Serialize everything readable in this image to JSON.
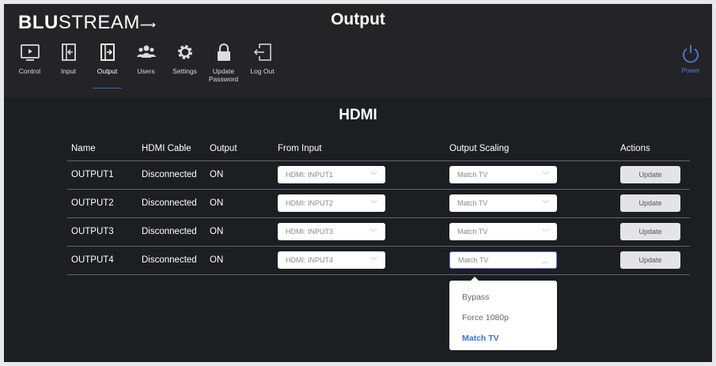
{
  "header": {
    "brand_bold": "BLU",
    "brand_light": "STREAM",
    "title": "Output"
  },
  "nav": [
    {
      "label": "Control",
      "icon": "tv-play-icon"
    },
    {
      "label": "Input",
      "icon": "input-icon"
    },
    {
      "label": "Output",
      "icon": "output-icon",
      "active": true
    },
    {
      "label": "Users",
      "icon": "users-icon"
    },
    {
      "label": "Settings",
      "icon": "gear-icon"
    },
    {
      "label": "Update Password",
      "icon": "lock-icon"
    },
    {
      "label": "Log Out",
      "icon": "logout-icon"
    }
  ],
  "power": {
    "label": "Power"
  },
  "section_title": "HDMI",
  "columns": [
    "Name",
    "HDMI Cable",
    "Output",
    "From Input",
    "Output Scaling",
    "Actions"
  ],
  "rows": [
    {
      "name": "OUTPUT1",
      "cable": "Disconnected",
      "output": "ON",
      "input": "HDMI: INPUT1",
      "scaling": "Match TV",
      "action": "Update"
    },
    {
      "name": "OUTPUT2",
      "cable": "Disconnected",
      "output": "ON",
      "input": "HDMI: INPUT2",
      "scaling": "Match TV",
      "action": "Update"
    },
    {
      "name": "OUTPUT3",
      "cable": "Disconnected",
      "output": "ON",
      "input": "HDMI: INPUT3",
      "scaling": "Match TV",
      "action": "Update"
    },
    {
      "name": "OUTPUT4",
      "cable": "Disconnected",
      "output": "ON",
      "input": "HDMI: INPUT4",
      "scaling": "Match TV",
      "action": "Update"
    }
  ],
  "scaling_menu": {
    "options": [
      "Bypass",
      "Force 1080p",
      "Match TV"
    ],
    "selected": "Match TV"
  },
  "colors": {
    "accent": "#3a6fd8",
    "background": "#1d1e22"
  }
}
